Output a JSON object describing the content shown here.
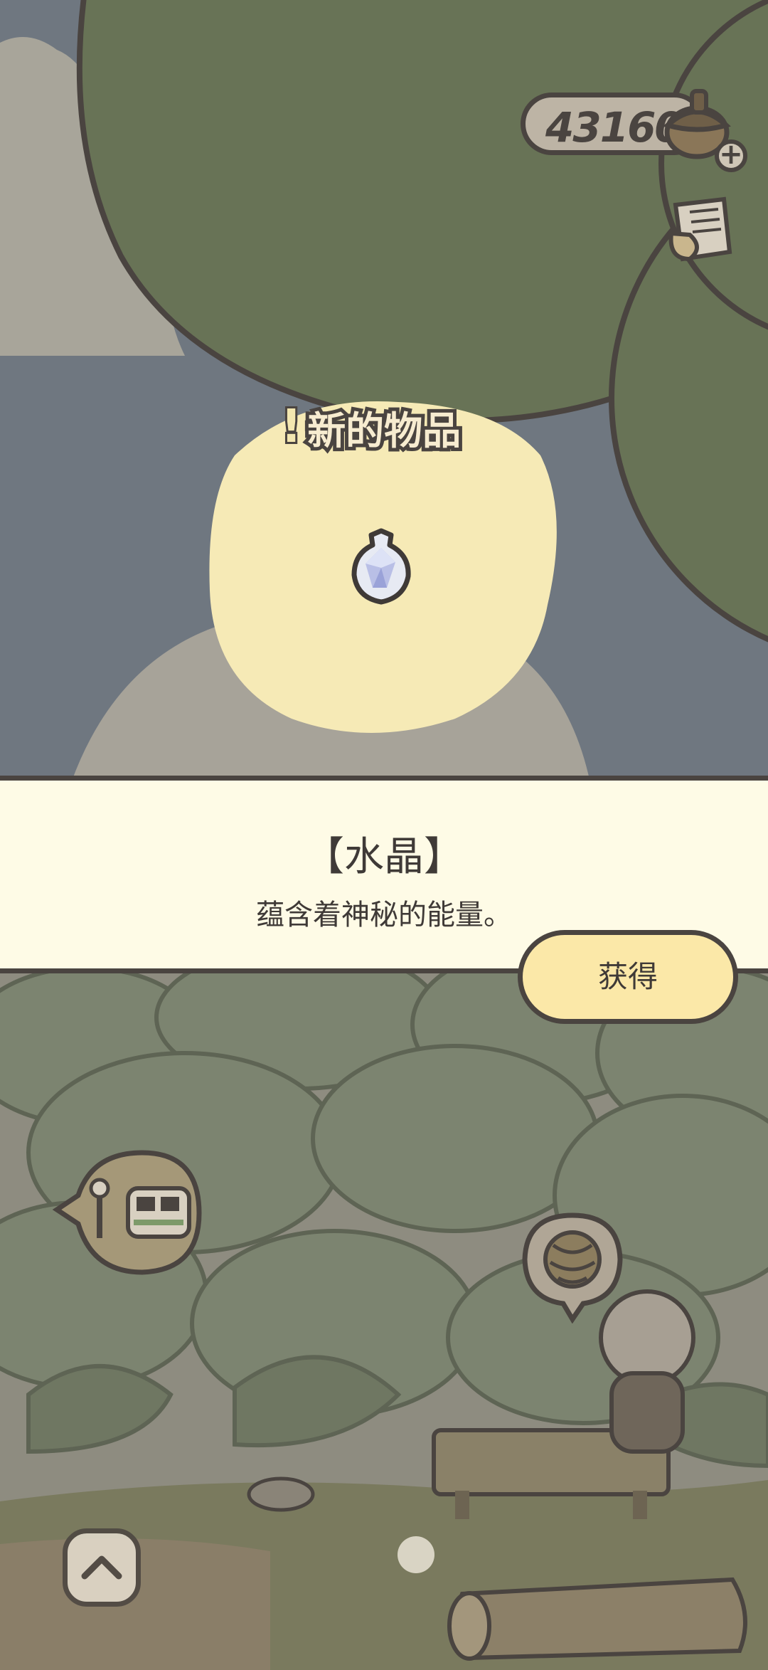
{
  "hud": {
    "currency_value": "431607",
    "currency_icon": "acorn-icon",
    "add_icon": "plus-icon",
    "add_label": "+",
    "notes_icon": "note-scroll-icon"
  },
  "map": {
    "new_item_mark": "!",
    "new_item_label": "新的物品",
    "item_icon": "crystal-icon"
  },
  "item_panel": {
    "title": "【水晶】",
    "description": "蕴含着神秘的能量。",
    "obtain_label": "获得"
  },
  "scene": {
    "bus_stop_icon": "bus-stop-icon",
    "yarn_icon": "yarn-ball-icon",
    "collapse_icon": "chevron-up-icon"
  },
  "colors": {
    "outline": "#4a4440",
    "panel": "#fefbe6",
    "button": "#fbe8a8",
    "highlight": "#f6eab6",
    "leaf": "#687356"
  }
}
